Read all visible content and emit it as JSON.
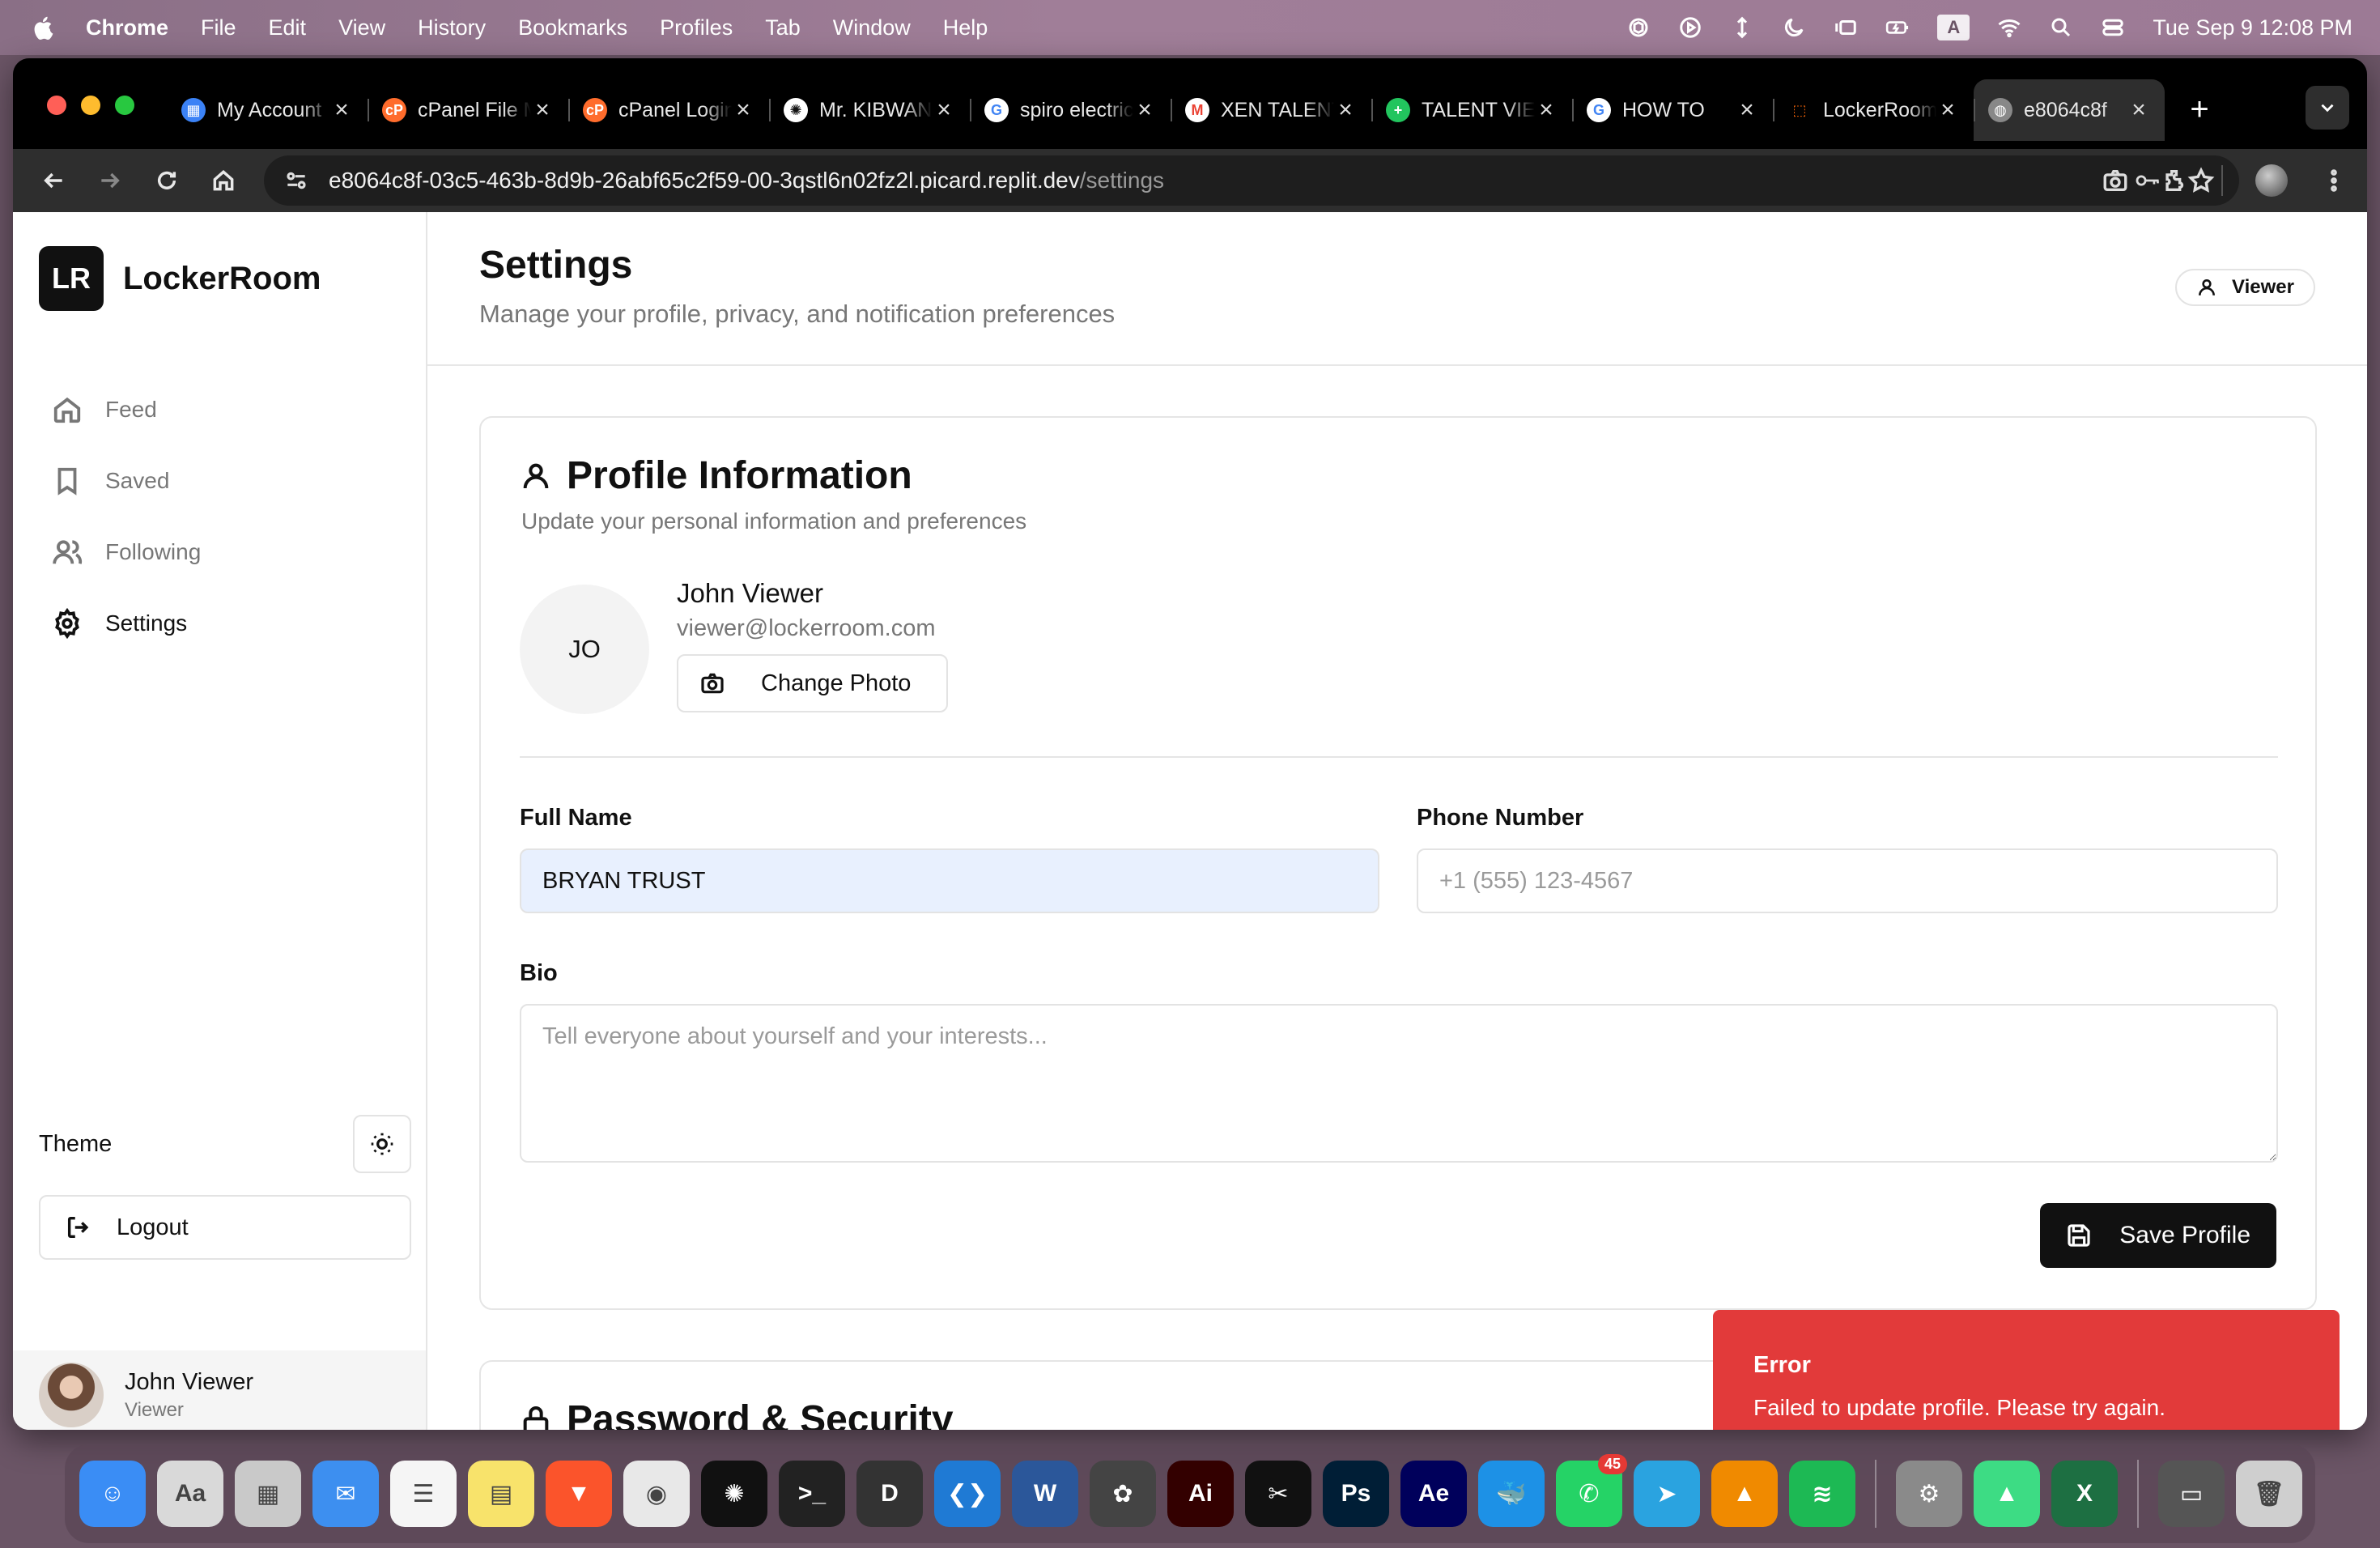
{
  "menubar": {
    "app": "Chrome",
    "items": [
      "File",
      "Edit",
      "View",
      "History",
      "Bookmarks",
      "Profiles",
      "Tab",
      "Window",
      "Help"
    ],
    "input_indicator": "A",
    "clock": "Tue Sep 9  12:08 PM"
  },
  "browser": {
    "tabs": [
      {
        "title": "My Account",
        "favicon": "grid-icon",
        "color": "#3b82f6"
      },
      {
        "title": "cPanel File Manager",
        "favicon": "cpanel-icon",
        "color": "#ff6c2c"
      },
      {
        "title": "cPanel Login",
        "favicon": "cpanel-icon",
        "color": "#ff6c2c"
      },
      {
        "title": "Mr. KIBWANA",
        "favicon": "chatgpt-icon",
        "color": "#ffffff"
      },
      {
        "title": "spiro electric",
        "favicon": "google-icon",
        "color": "#ffffff"
      },
      {
        "title": "XEN TALENT",
        "favicon": "gmail-icon",
        "color": "#ea4335"
      },
      {
        "title": "TALENT VIEW",
        "favicon": "plus-circle-icon",
        "color": "#22c55e"
      },
      {
        "title": "HOW TO",
        "favicon": "google-icon",
        "color": "#ffffff"
      },
      {
        "title": "LockerRoom",
        "favicon": "replit-icon",
        "color": "#f26207"
      },
      {
        "title": "e8064c8f",
        "favicon": "globe-icon",
        "color": "#888888",
        "active": true
      }
    ],
    "url_host": "e8064c8f-03c5-463b-8d9b-26abf65c2f59-00-3qstl6n02fz2l.picard.replit.dev",
    "url_path": "/settings"
  },
  "sidebar": {
    "logo": "LR",
    "brand": "LockerRoom",
    "nav": [
      {
        "label": "Feed",
        "icon": "home-icon"
      },
      {
        "label": "Saved",
        "icon": "bookmark-icon"
      },
      {
        "label": "Following",
        "icon": "users-icon"
      },
      {
        "label": "Settings",
        "icon": "gear-icon",
        "active": true
      }
    ],
    "theme_label": "Theme",
    "logout_label": "Logout",
    "user": {
      "name": "John Viewer",
      "role": "Viewer"
    }
  },
  "header": {
    "title": "Settings",
    "subtitle": "Manage your profile, privacy, and notification preferences",
    "role_badge": "Viewer"
  },
  "profile": {
    "title": "Profile Information",
    "subtitle": "Update your personal information and preferences",
    "avatar_initials": "JO",
    "name": "John Viewer",
    "email": "viewer@lockerroom.com",
    "change_photo": "Change Photo",
    "full_name_label": "Full Name",
    "full_name_value": "BRYAN TRUST",
    "phone_label": "Phone Number",
    "phone_placeholder": "+1 (555) 123-4567",
    "bio_label": "Bio",
    "bio_placeholder": "Tell everyone about yourself and your interests...",
    "save_label": "Save Profile"
  },
  "security": {
    "title": "Password & Security"
  },
  "toast": {
    "title": "Error",
    "message": "Failed to update profile. Please try again.",
    "color": "#e23a3a"
  },
  "dock": {
    "apps": [
      {
        "name": "finder-icon",
        "color": "#3a8df5",
        "glyph": "☺"
      },
      {
        "name": "font-book-icon",
        "color": "#d9d9d9",
        "glyph": "Aa"
      },
      {
        "name": "launchpad-icon",
        "color": "#c9c9c9",
        "glyph": "▦"
      },
      {
        "name": "mail-icon",
        "color": "#3d8ff0",
        "glyph": "✉"
      },
      {
        "name": "reminders-icon",
        "color": "#f5f5f5",
        "glyph": "☰"
      },
      {
        "name": "notes-icon",
        "color": "#f8e36b",
        "glyph": "▤"
      },
      {
        "name": "brave-icon",
        "color": "#fb542b",
        "glyph": "▼"
      },
      {
        "name": "chrome-icon",
        "color": "#e8e8e8",
        "glyph": "◉"
      },
      {
        "name": "chatgpt-icon",
        "color": "#111111",
        "glyph": "✺"
      },
      {
        "name": "terminal-icon",
        "color": "#222222",
        "glyph": ">_"
      },
      {
        "name": "cursor-icon",
        "color": "#333333",
        "glyph": "D"
      },
      {
        "name": "vscode-icon",
        "color": "#1f7ad4",
        "glyph": "❮❯"
      },
      {
        "name": "word-icon",
        "color": "#2b579a",
        "glyph": "W"
      },
      {
        "name": "davinci-icon",
        "color": "#444444",
        "glyph": "✿"
      },
      {
        "name": "illustrator-icon",
        "color": "#330000",
        "glyph": "Ai"
      },
      {
        "name": "capcut-icon",
        "color": "#111111",
        "glyph": "✂"
      },
      {
        "name": "photoshop-icon",
        "color": "#001e36",
        "glyph": "Ps"
      },
      {
        "name": "after-effects-icon",
        "color": "#00005b",
        "glyph": "Ae"
      },
      {
        "name": "docker-icon",
        "color": "#1d91e6",
        "glyph": "🐳"
      },
      {
        "name": "whatsapp-icon",
        "color": "#25d366",
        "glyph": "✆",
        "badge": "45"
      },
      {
        "name": "telegram-icon",
        "color": "#2aa3e0",
        "glyph": "➤"
      },
      {
        "name": "vlc-icon",
        "color": "#f08a00",
        "glyph": "▲"
      },
      {
        "name": "spotify-icon",
        "color": "#1db954",
        "glyph": "≋"
      },
      {
        "name": "system-settings-icon",
        "color": "#8a8a8a",
        "glyph": "⚙"
      },
      {
        "name": "android-studio-icon",
        "color": "#3ddc84",
        "glyph": "▲"
      },
      {
        "name": "excel-icon",
        "color": "#1d6f42",
        "glyph": "X"
      },
      {
        "name": "downloads-icon",
        "color": "#555555",
        "glyph": "▭"
      },
      {
        "name": "trash-icon",
        "color": "#cfcfcf",
        "glyph": "🗑"
      }
    ]
  }
}
